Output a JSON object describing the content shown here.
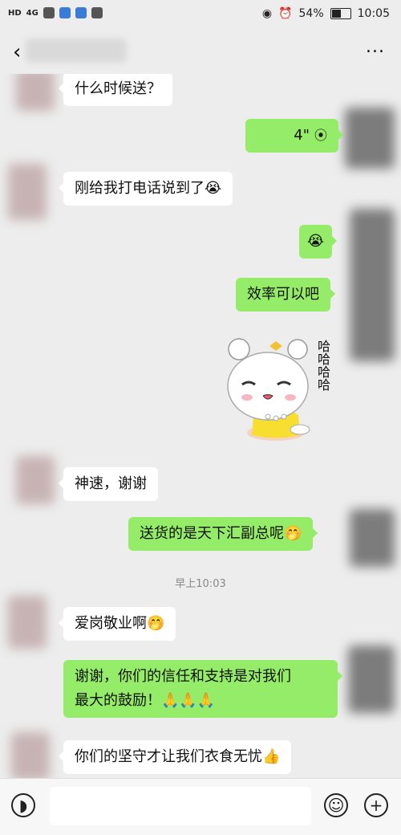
{
  "status_bar": {
    "network": "4G",
    "battery_text": "54%",
    "battery_level": 0.54,
    "time": "10:05"
  },
  "header": {
    "back_icon": "chevron-left-icon",
    "more_icon": "more-dots-icon",
    "more_text": "..."
  },
  "messages": [
    {
      "side": "left",
      "text": "什么时候送？"
    },
    {
      "side": "right",
      "type": "voice",
      "text": "4\""
    },
    {
      "side": "left",
      "text": "刚给我打电话说到了",
      "emoji": "😭"
    },
    {
      "side": "right",
      "text": "",
      "emoji": "😭"
    },
    {
      "side": "right",
      "text": "效率可以吧"
    },
    {
      "side": "right",
      "type": "sticker",
      "caption": "哈哈哈哈"
    },
    {
      "side": "left",
      "text": "神速，谢谢"
    },
    {
      "side": "right",
      "text": "送货的是天下汇副总呢",
      "emoji": "🤭"
    },
    {
      "type": "timestamp",
      "text": "早上10:03"
    },
    {
      "side": "left",
      "text": "爱岗敬业啊",
      "emoji": "🤭"
    },
    {
      "side": "right",
      "text_line1": "谢谢，你们的信任和支持是对我们",
      "text_line2": "最大的鼓励！",
      "emoji": "🙏🙏🙏"
    },
    {
      "side": "left",
      "text": "你们的坚守才让我们衣食无忧",
      "emoji": "👍"
    }
  ],
  "input_bar": {
    "voice_icon": "voice-input-icon",
    "emoji_icon": "emoji-icon",
    "plus_icon": "plus-icon"
  }
}
